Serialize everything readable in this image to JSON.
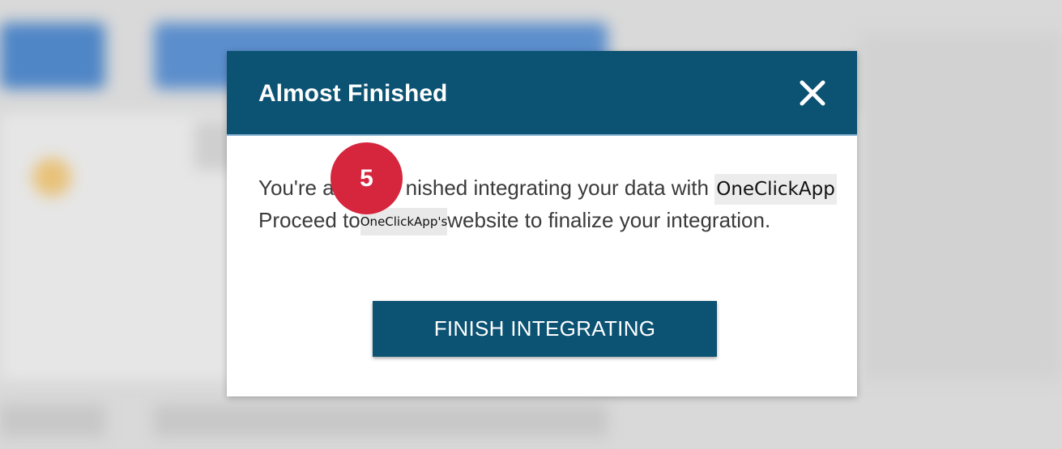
{
  "modal": {
    "title": "Almost Finished",
    "body_line1_prefix": "You're a",
    "body_line1_suffix": "nished integrating your data with ",
    "app_name": "OneClickApp",
    "body_line2_prefix": "Proceed to",
    "app_name_possessive": "OneClickApp's",
    "body_line2_suffix": "website to finalize your integration.",
    "finish_button_label": "FINISH INTEGRATING",
    "close_icon": "close-icon"
  },
  "step_badge": {
    "number": "5",
    "color": "#d6263e"
  },
  "colors": {
    "header": "#0b5273",
    "button": "#0b5273"
  }
}
